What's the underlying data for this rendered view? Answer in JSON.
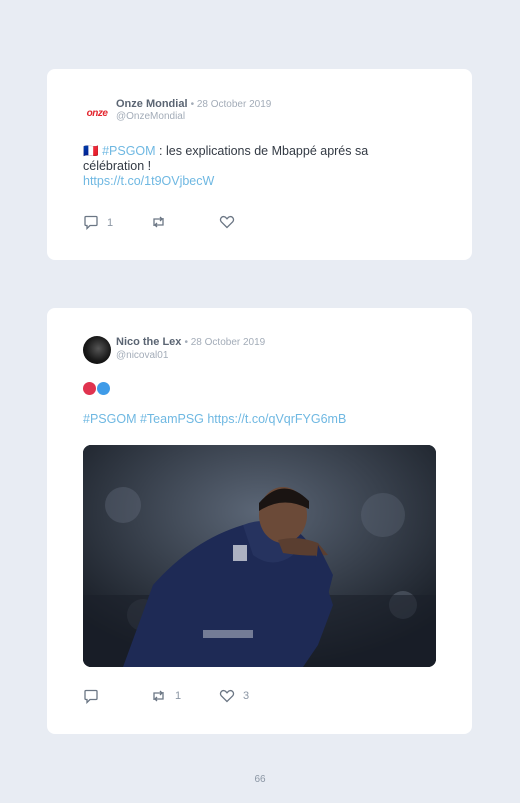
{
  "tweets": [
    {
      "name": "Onze Mondial",
      "date": "• 28 October 2019",
      "handle": "@OnzeMondial",
      "avatar_text": "onze",
      "flag": "🇫🇷",
      "hashtag": "#PSGOM",
      "text_rest": " : les explications de Mbappé aprés sa célébration !",
      "url": "https://t.co/1t9OVjbecW",
      "replies": "1",
      "retweets": "",
      "likes": ""
    },
    {
      "name": "Nico the Lex",
      "date": "• 28 October 2019",
      "handle": "@nicoval01",
      "tags": "#PSGOM #TeamPSG",
      "url": "https://t.co/qVqrFYG6mB",
      "replies": "",
      "retweets": "1",
      "likes": "3"
    }
  ],
  "colors": {
    "dot_red": "#e0334f",
    "dot_blue": "#3f9be8",
    "link": "#6fb8e2",
    "background": "#e8ecf3"
  },
  "page_number": "66"
}
